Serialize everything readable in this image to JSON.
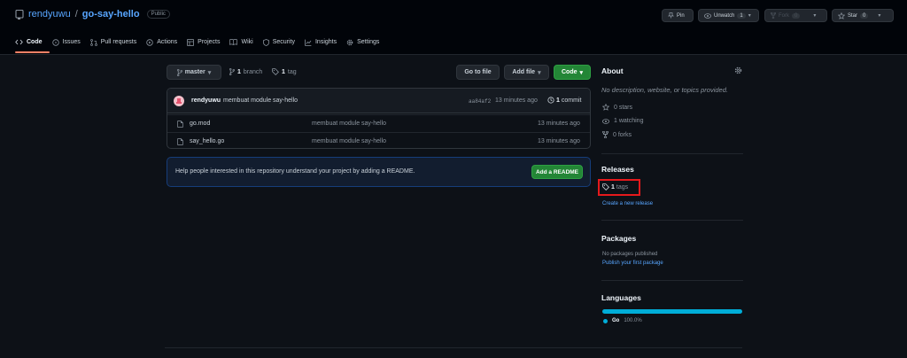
{
  "repo": {
    "owner": "rendyuwu",
    "separator": "/",
    "name": "go-say-hello",
    "visibility": "Public"
  },
  "header_actions": {
    "pin": "Pin",
    "unwatch": "Unwatch",
    "unwatch_count": "1",
    "fork": "Fork",
    "fork_count": "0",
    "star": "Star",
    "star_count": "0"
  },
  "tabs": [
    {
      "label": "Code"
    },
    {
      "label": "Issues"
    },
    {
      "label": "Pull requests"
    },
    {
      "label": "Actions"
    },
    {
      "label": "Projects"
    },
    {
      "label": "Wiki"
    },
    {
      "label": "Security"
    },
    {
      "label": "Insights"
    },
    {
      "label": "Settings"
    }
  ],
  "toolbar": {
    "branch": "master",
    "branch_count": "1",
    "branch_word": "branch",
    "tag_count": "1",
    "tag_word": "tag",
    "go_to_file": "Go to file",
    "add_file": "Add file",
    "code": "Code"
  },
  "commit": {
    "author": "rendyuwu",
    "message": "membuat module say-hello",
    "sha": "aa84af2",
    "time": "13 minutes ago",
    "count": "1",
    "count_word": "commit"
  },
  "files": [
    {
      "name": "go.mod",
      "message": "membuat module say-hello",
      "time": "13 minutes ago"
    },
    {
      "name": "say_hello.go",
      "message": "membuat module say-hello",
      "time": "13 minutes ago"
    }
  ],
  "readme": {
    "text": "Help people interested in this repository understand your project by adding a README.",
    "button": "Add a README"
  },
  "about": {
    "title": "About",
    "description": "No description, website, or topics provided.",
    "stars": "0 stars",
    "watching": "1 watching",
    "forks": "0 forks"
  },
  "releases": {
    "title": "Releases",
    "tags_count": "1",
    "tags_word": "tags",
    "create": "Create a new release"
  },
  "packages": {
    "title": "Packages",
    "none": "No packages published",
    "publish": "Publish your first package"
  },
  "languages": {
    "title": "Languages",
    "lang": "Go",
    "percent": "100.0%",
    "color": "#00add8",
    "fraction": 1.0
  },
  "colors": {
    "accent": "#58a6ff",
    "green": "#238636",
    "highlight": "#e5191c",
    "tab_underline": "#f78166"
  }
}
